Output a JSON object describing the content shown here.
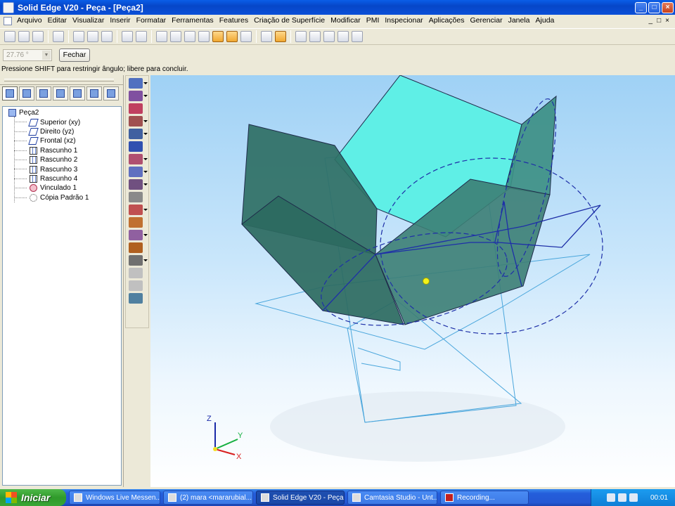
{
  "window": {
    "title": "Solid Edge V20 - Peça - [Peça2]",
    "buttons": [
      "_",
      "□",
      "×"
    ]
  },
  "menubar": {
    "items": [
      "Arquivo",
      "Editar",
      "Visualizar",
      "Inserir",
      "Formatar",
      "Ferramentas",
      "Features",
      "Criação de Superfície",
      "Modificar",
      "PMI",
      "Inspecionar",
      "Aplicações",
      "Gerenciar",
      "Janela",
      "Ajuda"
    ],
    "mdi_controls": [
      "_",
      "□",
      "×"
    ]
  },
  "ribbon": {
    "angle_value": "27.76 °",
    "close_label": "Fechar"
  },
  "status": {
    "prompt": "Pressione SHIFT para restringir ângulo; libere para concluir."
  },
  "pathfinder": {
    "root": "Peça2",
    "items": [
      {
        "label": "Superior (xy)",
        "icon": "plane-icon"
      },
      {
        "label": "Direito (yz)",
        "icon": "plane-icon"
      },
      {
        "label": "Frontal (xz)",
        "icon": "plane-icon"
      },
      {
        "label": "Rascunho 1",
        "icon": "sketch-icon"
      },
      {
        "label": "Rascunho 2",
        "icon": "sketch-icon"
      },
      {
        "label": "Rascunho 3",
        "icon": "sketch-icon"
      },
      {
        "label": "Rascunho 4",
        "icon": "sketch-icon"
      },
      {
        "label": "Vinculado 1",
        "icon": "link-icon"
      },
      {
        "label": "Cópia Padrão 1",
        "icon": "pattern-icon"
      }
    ]
  },
  "triad": {
    "x": "X",
    "y": "Y",
    "z": "Z"
  },
  "taskbar": {
    "start": "Iniciar",
    "tasks": [
      "Windows Live Messen...",
      "(2) mara <mararubial...",
      "Solid Edge V20 - Peça...",
      "Camtasia Studio - Unt...",
      "Recording..."
    ],
    "clock": "00:01"
  },
  "colors": {
    "sky_top": "#9fd1f5",
    "face_dark": "#2f6f64",
    "face_light": "#5fefe6",
    "sketch_blue": "#1e2fa8"
  }
}
